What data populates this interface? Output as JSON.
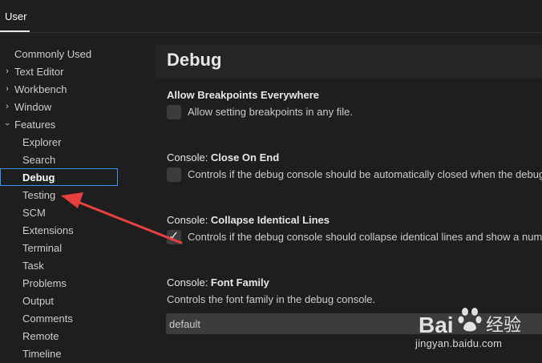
{
  "tabs": [
    {
      "label": "User"
    }
  ],
  "toc": [
    {
      "label": "Commonly Used",
      "level": 0,
      "chevron": ""
    },
    {
      "label": "Text Editor",
      "level": 0,
      "chevron": "chevron-right-icon"
    },
    {
      "label": "Workbench",
      "level": 0,
      "chevron": "chevron-right-icon"
    },
    {
      "label": "Window",
      "level": 0,
      "chevron": "chevron-right-icon"
    },
    {
      "label": "Features",
      "level": 0,
      "chevron": "chevron-down-icon"
    },
    {
      "label": "Explorer",
      "level": 1
    },
    {
      "label": "Search",
      "level": 1
    },
    {
      "label": "Debug",
      "level": 1,
      "selected": true
    },
    {
      "label": "Testing",
      "level": 1
    },
    {
      "label": "SCM",
      "level": 1
    },
    {
      "label": "Extensions",
      "level": 1
    },
    {
      "label": "Terminal",
      "level": 1
    },
    {
      "label": "Task",
      "level": 1
    },
    {
      "label": "Problems",
      "level": 1
    },
    {
      "label": "Output",
      "level": 1
    },
    {
      "label": "Comments",
      "level": 1
    },
    {
      "label": "Remote",
      "level": 1
    },
    {
      "label": "Timeline",
      "level": 1
    }
  ],
  "section": {
    "title": "Debug"
  },
  "settings": {
    "allow_breakpoints": {
      "title": "Allow Breakpoints Everywhere",
      "description": "Allow setting breakpoints in any file.",
      "checked": false
    },
    "close_on_end": {
      "category": "Console: ",
      "title": "Close On End",
      "description": "Controls if the debug console should be automatically closed when the debug",
      "checked": false
    },
    "collapse_identical": {
      "category": "Console: ",
      "title": "Collapse Identical Lines",
      "description": "Controls if the debug console should collapse identical lines and show a num",
      "checked": true
    },
    "font_family": {
      "category": "Console: ",
      "title": "Font Family",
      "description": "Controls the font family in the debug console.",
      "value": "default"
    }
  },
  "watermark": {
    "brand": "Bai",
    "brand2": "经验",
    "url": "jingyan.baidu.com"
  },
  "colors": {
    "background": "#1e1e1e",
    "accent_focus": "#3794ff",
    "annotation_arrow": "#e8413c"
  }
}
